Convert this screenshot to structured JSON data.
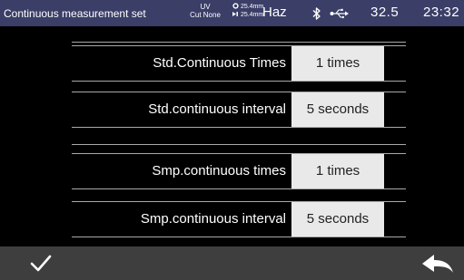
{
  "statusbar": {
    "title": "Continuous measurement set",
    "uv_label": "UV",
    "cut_label": "Cut None",
    "aperture_primary": "25.4mm",
    "aperture_secondary": "25.4mm",
    "mode": "Haz",
    "bluetooth_icon": "bluetooth-icon",
    "usb_icon": "usb-icon",
    "temperature": "32.5",
    "time": "23:32"
  },
  "settings": [
    {
      "label": "Std.Continuous Times",
      "value": "1 times"
    },
    {
      "label": "Std.continuous interval",
      "value": "5 seconds"
    },
    {
      "label": "Smp.continuous times",
      "value": "1 times"
    },
    {
      "label": "Smp.continuous interval",
      "value": "5 seconds"
    }
  ],
  "bottombar": {
    "confirm_icon": "checkmark-icon",
    "back_icon": "back-arrow-icon"
  },
  "colors": {
    "statusbar_bg": "#3b3e67",
    "background": "#000000",
    "value_box_bg": "#e9e9e9",
    "bottombar_bg": "#3e3e3e",
    "divider": "#a9a9a9"
  }
}
